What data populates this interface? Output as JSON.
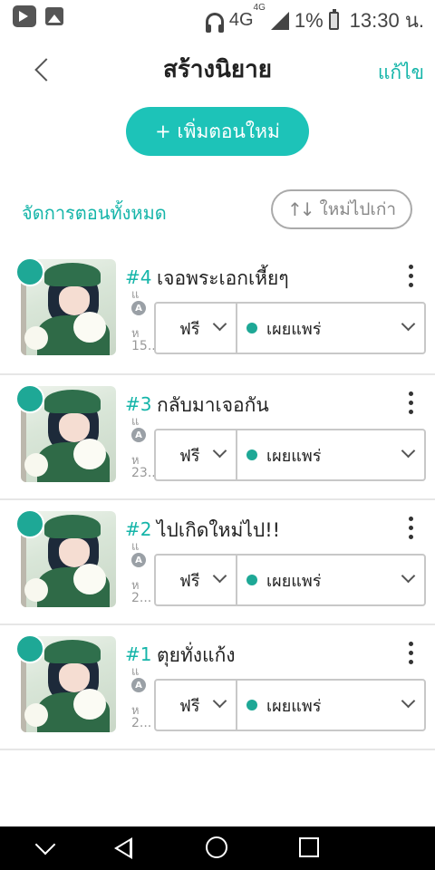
{
  "status_bar": {
    "network": "4G",
    "network_sup": "4G",
    "battery": "1%",
    "time": "13:30 น."
  },
  "header": {
    "title": "สร้างนิยาย",
    "edit_label": "แก้ไข"
  },
  "add_button": {
    "label": "+ เพิ่มตอนใหม่"
  },
  "manage_label": "จัดการตอนทั้งหมด",
  "sort": {
    "label": "ใหม่ไปเก่า",
    "icon": "↑↓"
  },
  "chapters": [
    {
      "number": "#4",
      "title": "เจอพระเอกเหี้ยๆ",
      "meta1": "แ",
      "meta2": "ห",
      "meta3": "15...",
      "price": "ฟรี",
      "status": "เผยแพร่"
    },
    {
      "number": "#3",
      "title": "กลับมาเจอกัน",
      "meta1": "แ",
      "meta2": "ห",
      "meta3": "23...",
      "price": "ฟรี",
      "status": "เผยแพร่"
    },
    {
      "number": "#2",
      "title": "ไปเกิดใหม่ไป!!",
      "meta1": "แ",
      "meta2": "ห",
      "meta3": "2...",
      "price": "ฟรี",
      "status": "เผยแพร่"
    },
    {
      "number": "#1",
      "title": "ตุยทั่งแก้ง",
      "meta1": "แ",
      "meta2": "ห",
      "meta3": "2...",
      "price": "ฟรี",
      "status": "เผยแพร่"
    }
  ],
  "colors": {
    "accent": "#1dc3b8",
    "status_dot": "#1ea896"
  }
}
